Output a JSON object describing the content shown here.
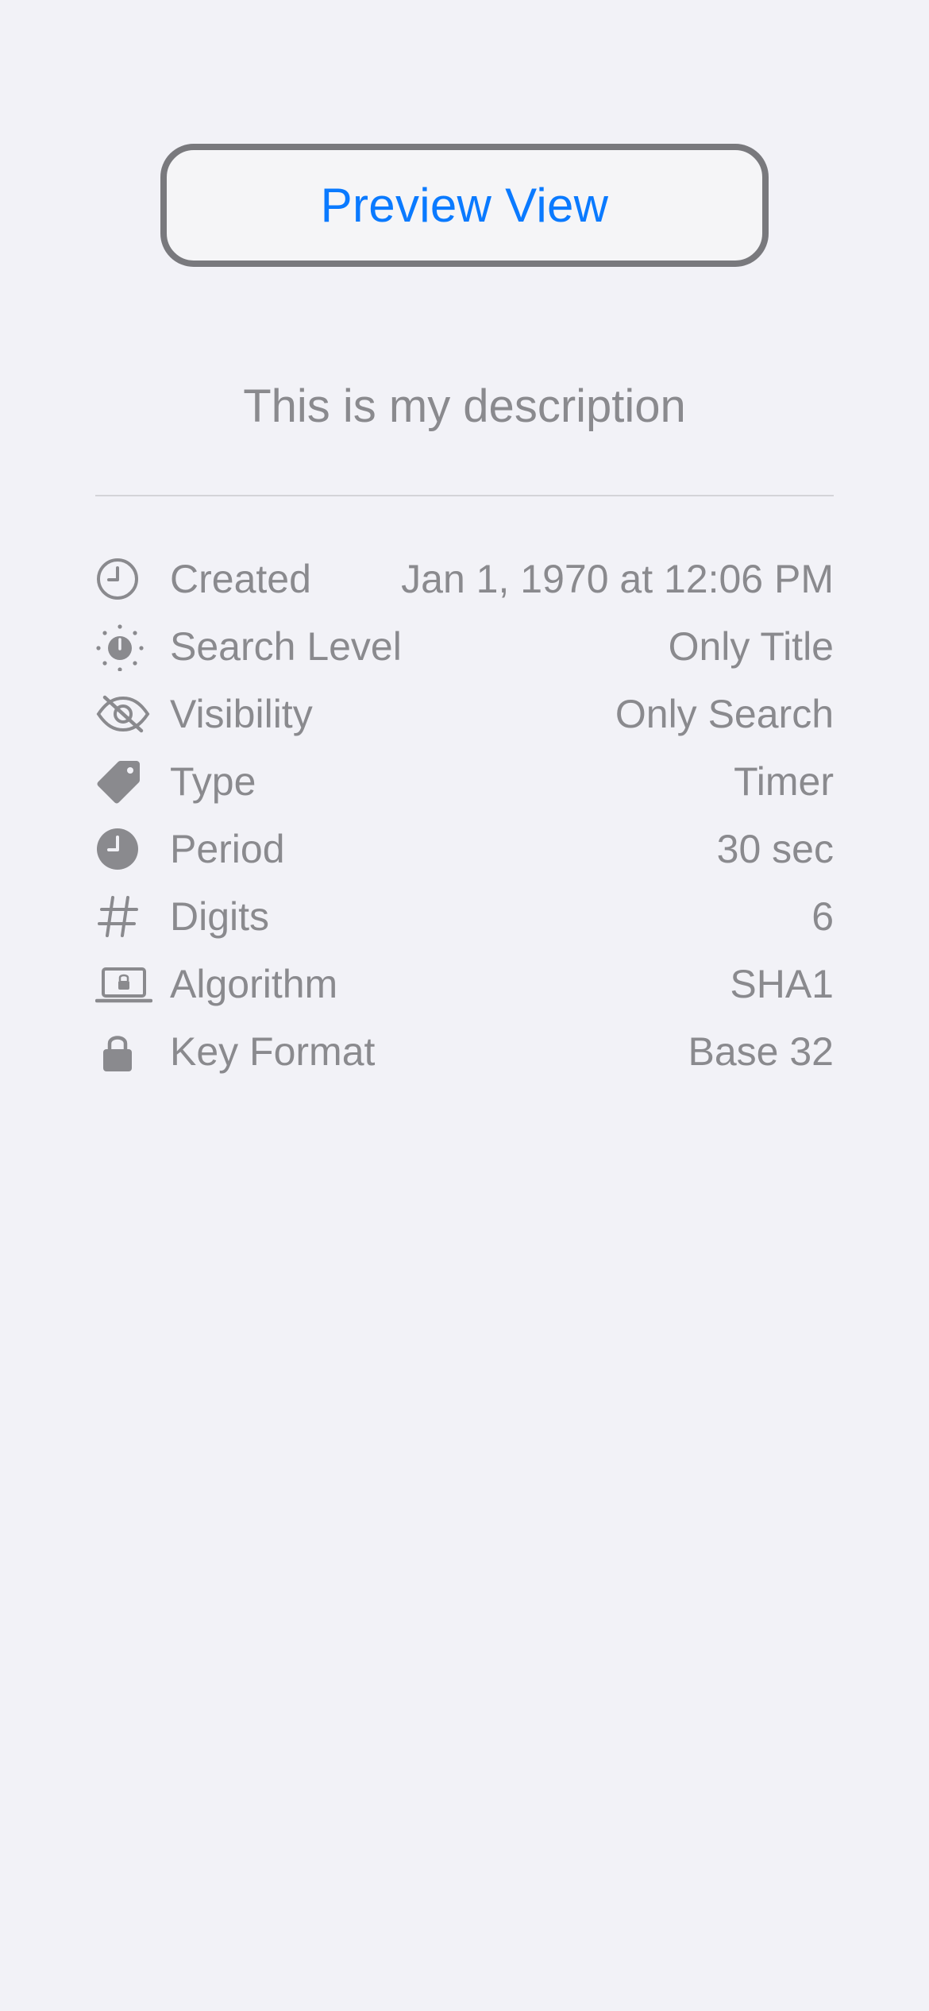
{
  "preview_button": {
    "label": "Preview View"
  },
  "description": "This is my description",
  "colors": {
    "accent": "#0a7aff",
    "secondary_text": "#8a8a8e",
    "button_border": "#79797d",
    "background": "#f2f2f7"
  },
  "details": [
    {
      "icon": "clock-outline-icon",
      "label": "Created",
      "value": "Jan 1, 1970 at 12:06 PM"
    },
    {
      "icon": "sun-timer-icon",
      "label": "Search Level",
      "value": "Only Title"
    },
    {
      "icon": "eye-slash-icon",
      "label": "Visibility",
      "value": "Only Search"
    },
    {
      "icon": "tag-icon",
      "label": "Type",
      "value": "Timer"
    },
    {
      "icon": "clock-fill-icon",
      "label": "Period",
      "value": "30 sec"
    },
    {
      "icon": "number-sign-icon",
      "label": "Digits",
      "value": "6"
    },
    {
      "icon": "laptop-lock-icon",
      "label": "Algorithm",
      "value": "SHA1"
    },
    {
      "icon": "lock-icon",
      "label": "Key Format",
      "value": "Base 32"
    }
  ]
}
